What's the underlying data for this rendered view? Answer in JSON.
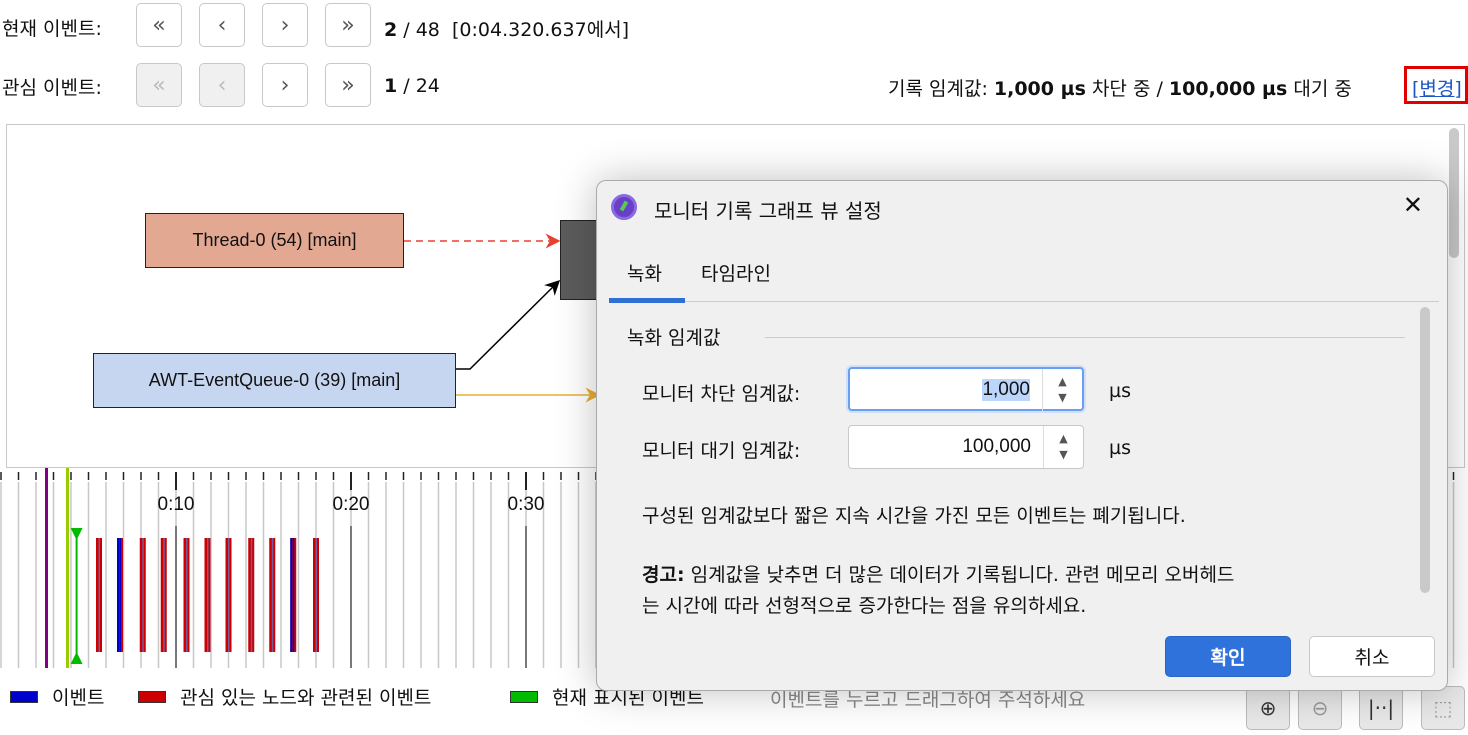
{
  "current_event": {
    "label": "현재 이벤트:",
    "index": "2",
    "sep": " / ",
    "total": "48",
    "time": "[0:04.320.637에서]"
  },
  "interest_event": {
    "label": "관심 이벤트:",
    "index": "1",
    "sep": " / ",
    "total": "24"
  },
  "nav_glyphs": {
    "first": "«",
    "prev": "‹",
    "next": "›",
    "last": "»"
  },
  "threshold": {
    "label": "기록 임계값:",
    "block": "1,000 µs",
    "block_suffix": " 차단 중 / ",
    "wait": "100,000 µs",
    "wait_suffix": " 대기 중",
    "change_link": "[변경]"
  },
  "graph": {
    "nodes": [
      {
        "label": "Thread-0 (54) [main]"
      },
      {
        "label": "AWT-EventQueue-0 (39) [main]"
      }
    ]
  },
  "timeline": {
    "tick_labels": [
      "0:10",
      "0:20",
      "0:30"
    ],
    "current_time_s": 4.32,
    "marker_purple_s": 2.6,
    "marker_lime_s": 3.8,
    "events": [
      {
        "t": 5.6,
        "type": "interest"
      },
      {
        "t": 6.8,
        "type": "event"
      },
      {
        "t": 8.1,
        "type": "interest"
      },
      {
        "t": 9.3,
        "type": "interest"
      },
      {
        "t": 10.6,
        "type": "interest"
      },
      {
        "t": 11.8,
        "type": "interest"
      },
      {
        "t": 13.0,
        "type": "interest"
      },
      {
        "t": 14.3,
        "type": "interest"
      },
      {
        "t": 15.5,
        "type": "interest"
      },
      {
        "t": 16.7,
        "type": "event"
      },
      {
        "t": 18.0,
        "type": "interest"
      }
    ]
  },
  "legend": [
    {
      "label": "이벤트",
      "color": "#0000cc"
    },
    {
      "label": "관심 있는 노드와 관련된 이벤트",
      "color": "#cc0000"
    },
    {
      "label": "현재 표시된 이벤트",
      "color": "#00bb00"
    }
  ],
  "hint": "이벤트를 누르고 드래그하여 주석하세요",
  "dialog": {
    "title": "모니터 기록 그래프 뷰 설정",
    "close": "✕",
    "tabs": [
      "녹화",
      "타임라인"
    ],
    "section": "녹화 임계값",
    "block_label": "모니터 차단 임계값:",
    "block_value": "1,000",
    "wait_label": "모니터 대기 임계값:",
    "wait_value": "100,000",
    "unit": "µs",
    "info": "구성된 임계값보다 짧은 지속 시간을 가진 모든 이벤트는 폐기됩니다.",
    "warning_bold": "경고:",
    "warning_line1": " 임계값을 낮추면 더 많은 데이터가 기록됩니다. 관련 메모리 오버헤드",
    "warning_line2": "는 시간에 따라 선형적으로 증가한다는 점을 유의하세요.",
    "ok": "확인",
    "cancel": "취소"
  }
}
